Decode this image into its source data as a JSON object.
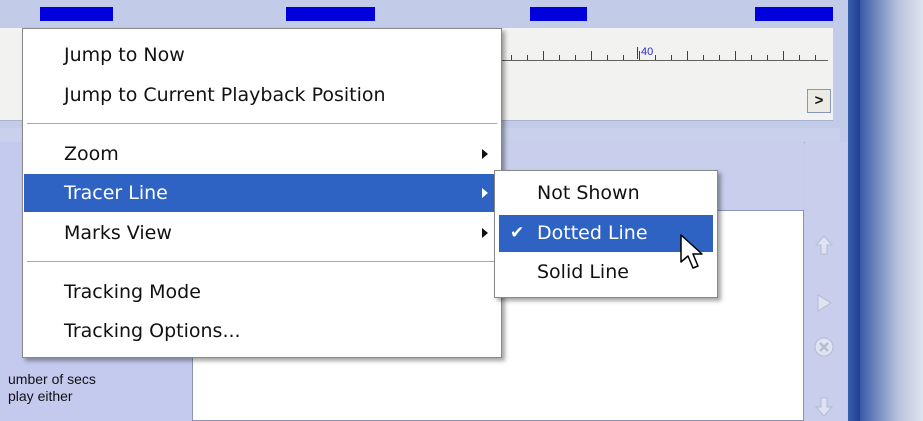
{
  "ruler": {
    "tick_label": "40"
  },
  "scroll_button": {
    "glyph": ">"
  },
  "left_panel": {
    "text_lines": [
      "umber of secs",
      "play either"
    ]
  },
  "main_menu": {
    "items": [
      {
        "label": "Jump to Now"
      },
      {
        "label": "Jump to Current Playback Position"
      },
      {
        "label": "Zoom",
        "submenu": true
      },
      {
        "label": "Tracer Line",
        "submenu": true,
        "highlighted": true
      },
      {
        "label": "Marks View",
        "submenu": true
      },
      {
        "label": "Tracking Mode"
      },
      {
        "label": "Tracking Options..."
      }
    ]
  },
  "sub_menu": {
    "items": [
      {
        "label": "Not Shown"
      },
      {
        "label": "Dotted Line",
        "checked": true,
        "highlighted": true,
        "check_glyph": "✔"
      },
      {
        "label": "Solid Line"
      }
    ]
  },
  "colors": {
    "highlight": "#2f63c3",
    "timeline_block": "#0000dd"
  }
}
